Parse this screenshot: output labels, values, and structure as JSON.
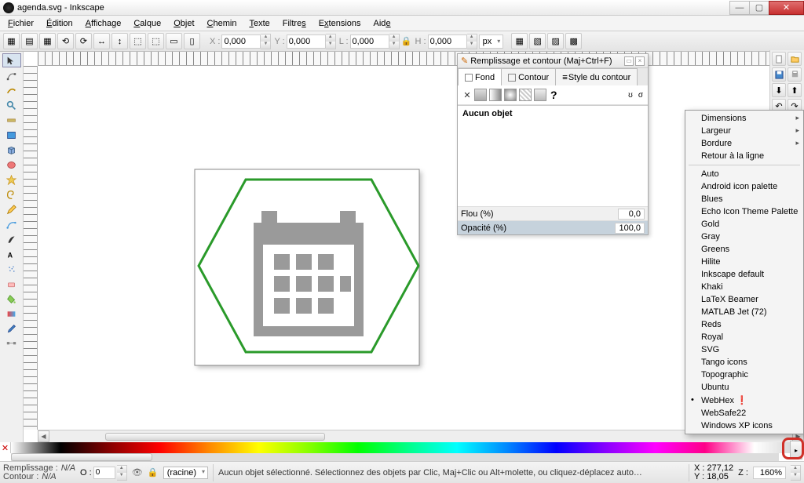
{
  "title": "agenda.svg - Inkscape",
  "menu": {
    "items": [
      "Fichier",
      "Édition",
      "Affichage",
      "Calque",
      "Objet",
      "Chemin",
      "Texte",
      "Filtres",
      "Extensions",
      "Aide"
    ]
  },
  "toolbar2": {
    "x_label": "X :",
    "x_val": "0,000",
    "y_label": "Y :",
    "y_val": "0,000",
    "w_label": "L :",
    "w_val": "0,000",
    "h_label": "H :",
    "h_val": "0,000",
    "unit": "px"
  },
  "panel": {
    "title": "Remplissage et contour (Maj+Ctrl+F)",
    "tabs": {
      "fill": "Fond",
      "stroke": "Contour",
      "stroke_style": "Style du contour"
    },
    "no_obj": "Aucun objet",
    "blur": {
      "label": "Flou (%)",
      "value": "0,0"
    },
    "opacity": {
      "label": "Opacité (%)",
      "value": "100,0"
    }
  },
  "ctx": {
    "sub": {
      "dim": "Dimensions",
      "wid": "Largeur",
      "bor": "Bordure"
    },
    "wrap": "Retour à la ligne",
    "items": [
      "Auto",
      "Android icon palette",
      "Blues",
      "Echo Icon Theme Palette",
      "Gold",
      "Gray",
      "Greens",
      "Hilite",
      "Inkscape default",
      "Khaki",
      "LaTeX Beamer",
      "MATLAB Jet (72)",
      "Reds",
      "Royal",
      "SVG",
      "Tango icons",
      "Topographic",
      "Ubuntu",
      "WebHex",
      "WebSafe22",
      "Windows XP icons"
    ],
    "selected": "WebHex"
  },
  "status": {
    "fill_label": "Remplissage :",
    "fill_val": "N/A",
    "stroke_label": "Contour :",
    "stroke_val": "N/A",
    "o_label": "O :",
    "o_val": "0",
    "layer": "(racine)",
    "msg": "Aucun objet sélectionné. Sélectionnez des objets par Clic, Maj+Clic ou Alt+molette, ou cliquez-déplacez auto…",
    "x_label": "X :",
    "x_val": "277,12",
    "y_label": "Y :",
    "y_val": "18,05",
    "z_label": "Z :",
    "z_val": "160%"
  }
}
